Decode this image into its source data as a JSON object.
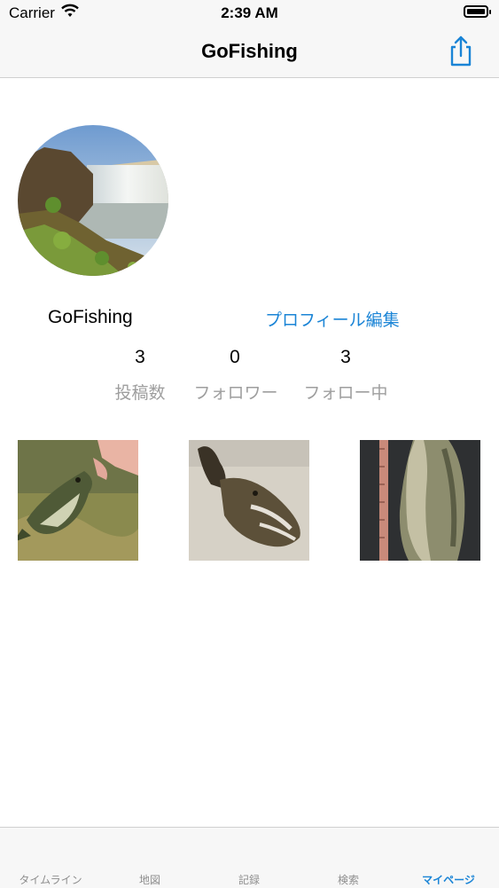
{
  "status_bar": {
    "carrier": "Carrier",
    "time": "2:39 AM"
  },
  "nav": {
    "title": "GoFishing",
    "share_icon": "share-icon",
    "accent_color": "#1a84d6"
  },
  "profile": {
    "username": "GoFishing",
    "edit_label": "プロフィール編集",
    "stats": [
      {
        "value": "3",
        "label": "投稿数"
      },
      {
        "value": "0",
        "label": "フォロワー"
      },
      {
        "value": "3",
        "label": "フォロー中"
      }
    ]
  },
  "tabs": [
    {
      "label": "タイムライン",
      "active": false
    },
    {
      "label": "地図",
      "active": false
    },
    {
      "label": "記録",
      "active": false
    },
    {
      "label": "検索",
      "active": false
    },
    {
      "label": "マイページ",
      "active": true
    }
  ]
}
